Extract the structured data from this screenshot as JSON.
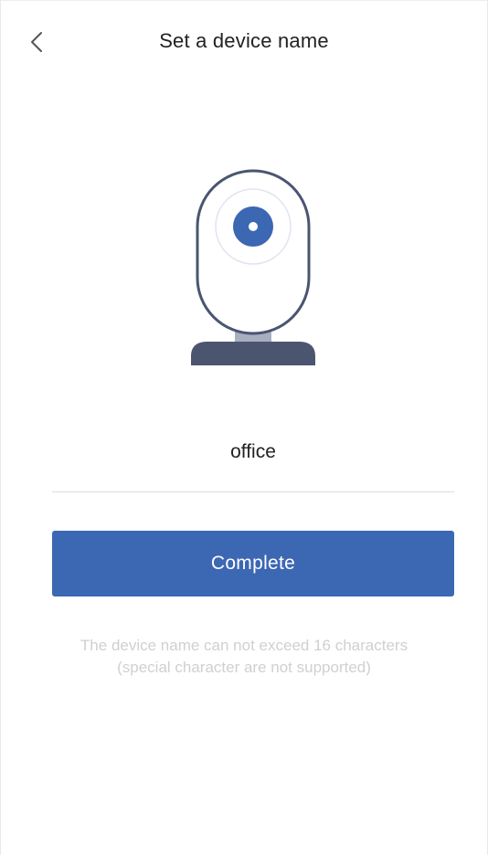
{
  "header": {
    "back_icon": "chevron-left-icon",
    "title": "Set a device name"
  },
  "device": {
    "illustration": "camera-icon"
  },
  "name_input": {
    "value": "office",
    "placeholder": ""
  },
  "complete_button": {
    "label": "Complete"
  },
  "hint": {
    "line1": "The device name can not exceed 16 characters",
    "line2": "(special character are not supported)"
  },
  "colors": {
    "primary": "#3c67b3",
    "camera_outline": "#4a5572",
    "camera_base": "#4c5570",
    "hint_text": "#d0d0d0",
    "title_text": "#222222"
  }
}
